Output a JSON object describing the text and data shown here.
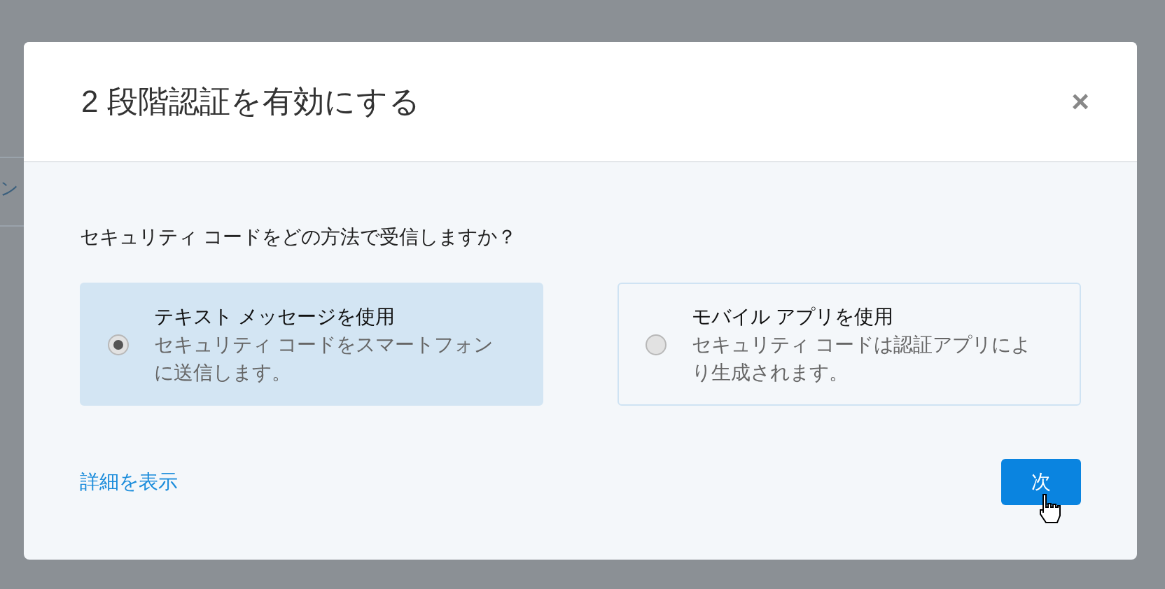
{
  "background": {
    "partial_text": "ン"
  },
  "dialog": {
    "title": "2 段階認証を有効にする",
    "close": "×",
    "question": "セキュリティ コードをどの方法で受信しますか？",
    "options": [
      {
        "title": "テキスト メッセージを使用",
        "description": "セキュリティ コードをスマートフォンに送信します。",
        "selected": true
      },
      {
        "title": "モバイル アプリを使用",
        "description": "セキュリティ コードは認証アプリにより生成されます。",
        "selected": false
      }
    ],
    "details_link": "詳細を表示",
    "next_button": "次"
  }
}
